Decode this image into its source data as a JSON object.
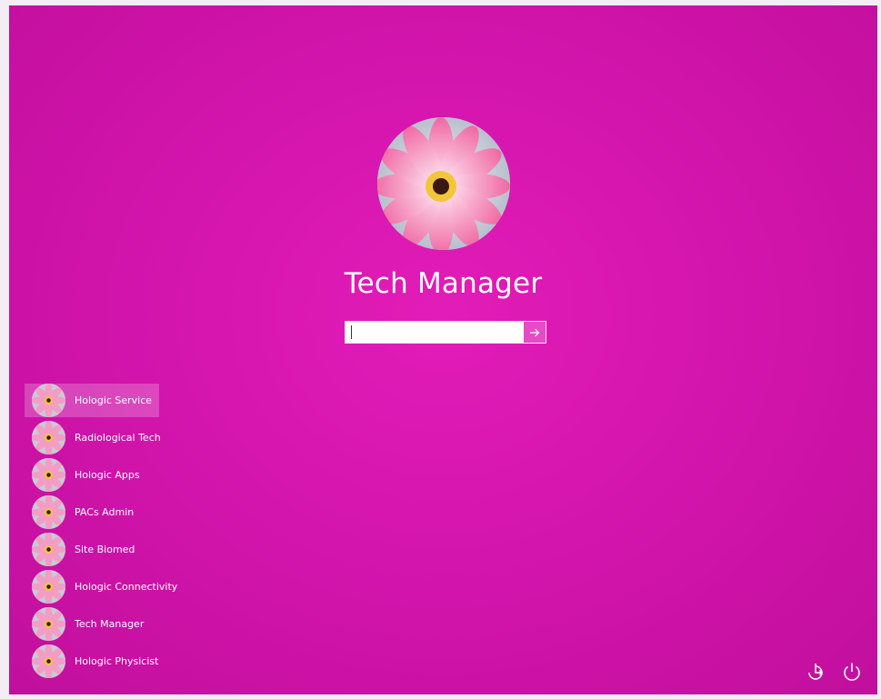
{
  "lock_screen": {
    "background_color": "#d415ad",
    "selected_user": {
      "name": "Tech Manager",
      "avatar_icon": "pink-flower-icon"
    },
    "password": {
      "value": "",
      "placeholder": "",
      "submit_icon": "arrow-right-icon"
    },
    "users": [
      {
        "label": "Hologic Service",
        "selected": true
      },
      {
        "label": "Radiological Tech"
      },
      {
        "label": "Hologic Apps"
      },
      {
        "label": "PACs Admin"
      },
      {
        "label": "Site Biomed"
      },
      {
        "label": "Hologic Connectivity"
      },
      {
        "label": "Tech Manager"
      },
      {
        "label": "Hologic Physicist"
      }
    ],
    "bottom_icons": [
      "ease-of-access-icon",
      "power-icon"
    ]
  }
}
